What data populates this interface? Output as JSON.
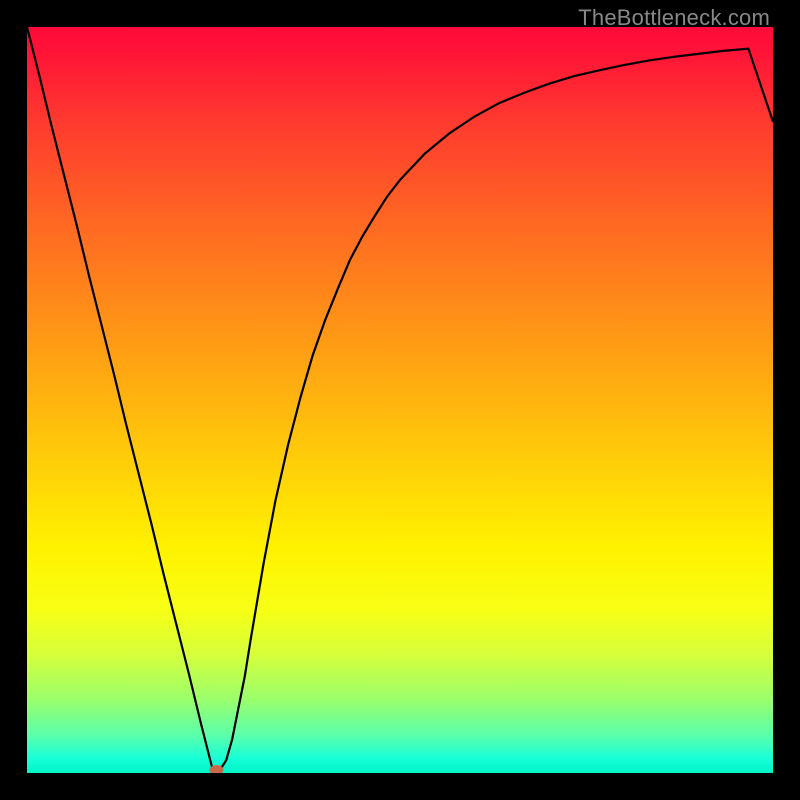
{
  "watermark": "TheBottleneck.com",
  "colors": {
    "frame": "#000000",
    "watermark_text": "#888888",
    "curve": "#000000",
    "marker": "#c86a4a",
    "gradient_stops": [
      "#ff0a3a",
      "#ff3b2f",
      "#ff6a22",
      "#ff9a15",
      "#ffc70a",
      "#fff200",
      "#f8ff14",
      "#d7ff3a",
      "#9cff6a",
      "#5affac",
      "#19ffd8",
      "#00f5c8"
    ]
  },
  "chart_data": {
    "type": "line",
    "title": "",
    "xlabel": "",
    "ylabel": "",
    "xlim": [
      0,
      1
    ],
    "ylim": [
      0,
      1
    ],
    "x": [
      0.0,
      0.017,
      0.033,
      0.05,
      0.067,
      0.083,
      0.1,
      0.117,
      0.133,
      0.15,
      0.167,
      0.183,
      0.2,
      0.217,
      0.233,
      0.25,
      0.254,
      0.258,
      0.267,
      0.275,
      0.283,
      0.292,
      0.3,
      0.317,
      0.333,
      0.35,
      0.367,
      0.383,
      0.4,
      0.417,
      0.433,
      0.45,
      0.467,
      0.483,
      0.5,
      0.533,
      0.567,
      0.6,
      0.633,
      0.667,
      0.7,
      0.733,
      0.767,
      0.8,
      0.833,
      0.867,
      0.9,
      0.933,
      0.967,
      1.0
    ],
    "y": [
      1.0,
      0.933,
      0.867,
      0.8,
      0.733,
      0.667,
      0.6,
      0.533,
      0.467,
      0.4,
      0.333,
      0.267,
      0.2,
      0.133,
      0.067,
      0.0,
      0.0,
      0.003,
      0.017,
      0.045,
      0.085,
      0.13,
      0.18,
      0.28,
      0.365,
      0.44,
      0.505,
      0.56,
      0.608,
      0.65,
      0.688,
      0.72,
      0.748,
      0.773,
      0.795,
      0.83,
      0.858,
      0.88,
      0.898,
      0.912,
      0.924,
      0.934,
      0.942,
      0.949,
      0.955,
      0.96,
      0.964,
      0.968,
      0.971,
      0.873
    ],
    "marker": {
      "x": 0.254,
      "y": 0.0
    },
    "background": "rainbow-vertical-gradient"
  }
}
